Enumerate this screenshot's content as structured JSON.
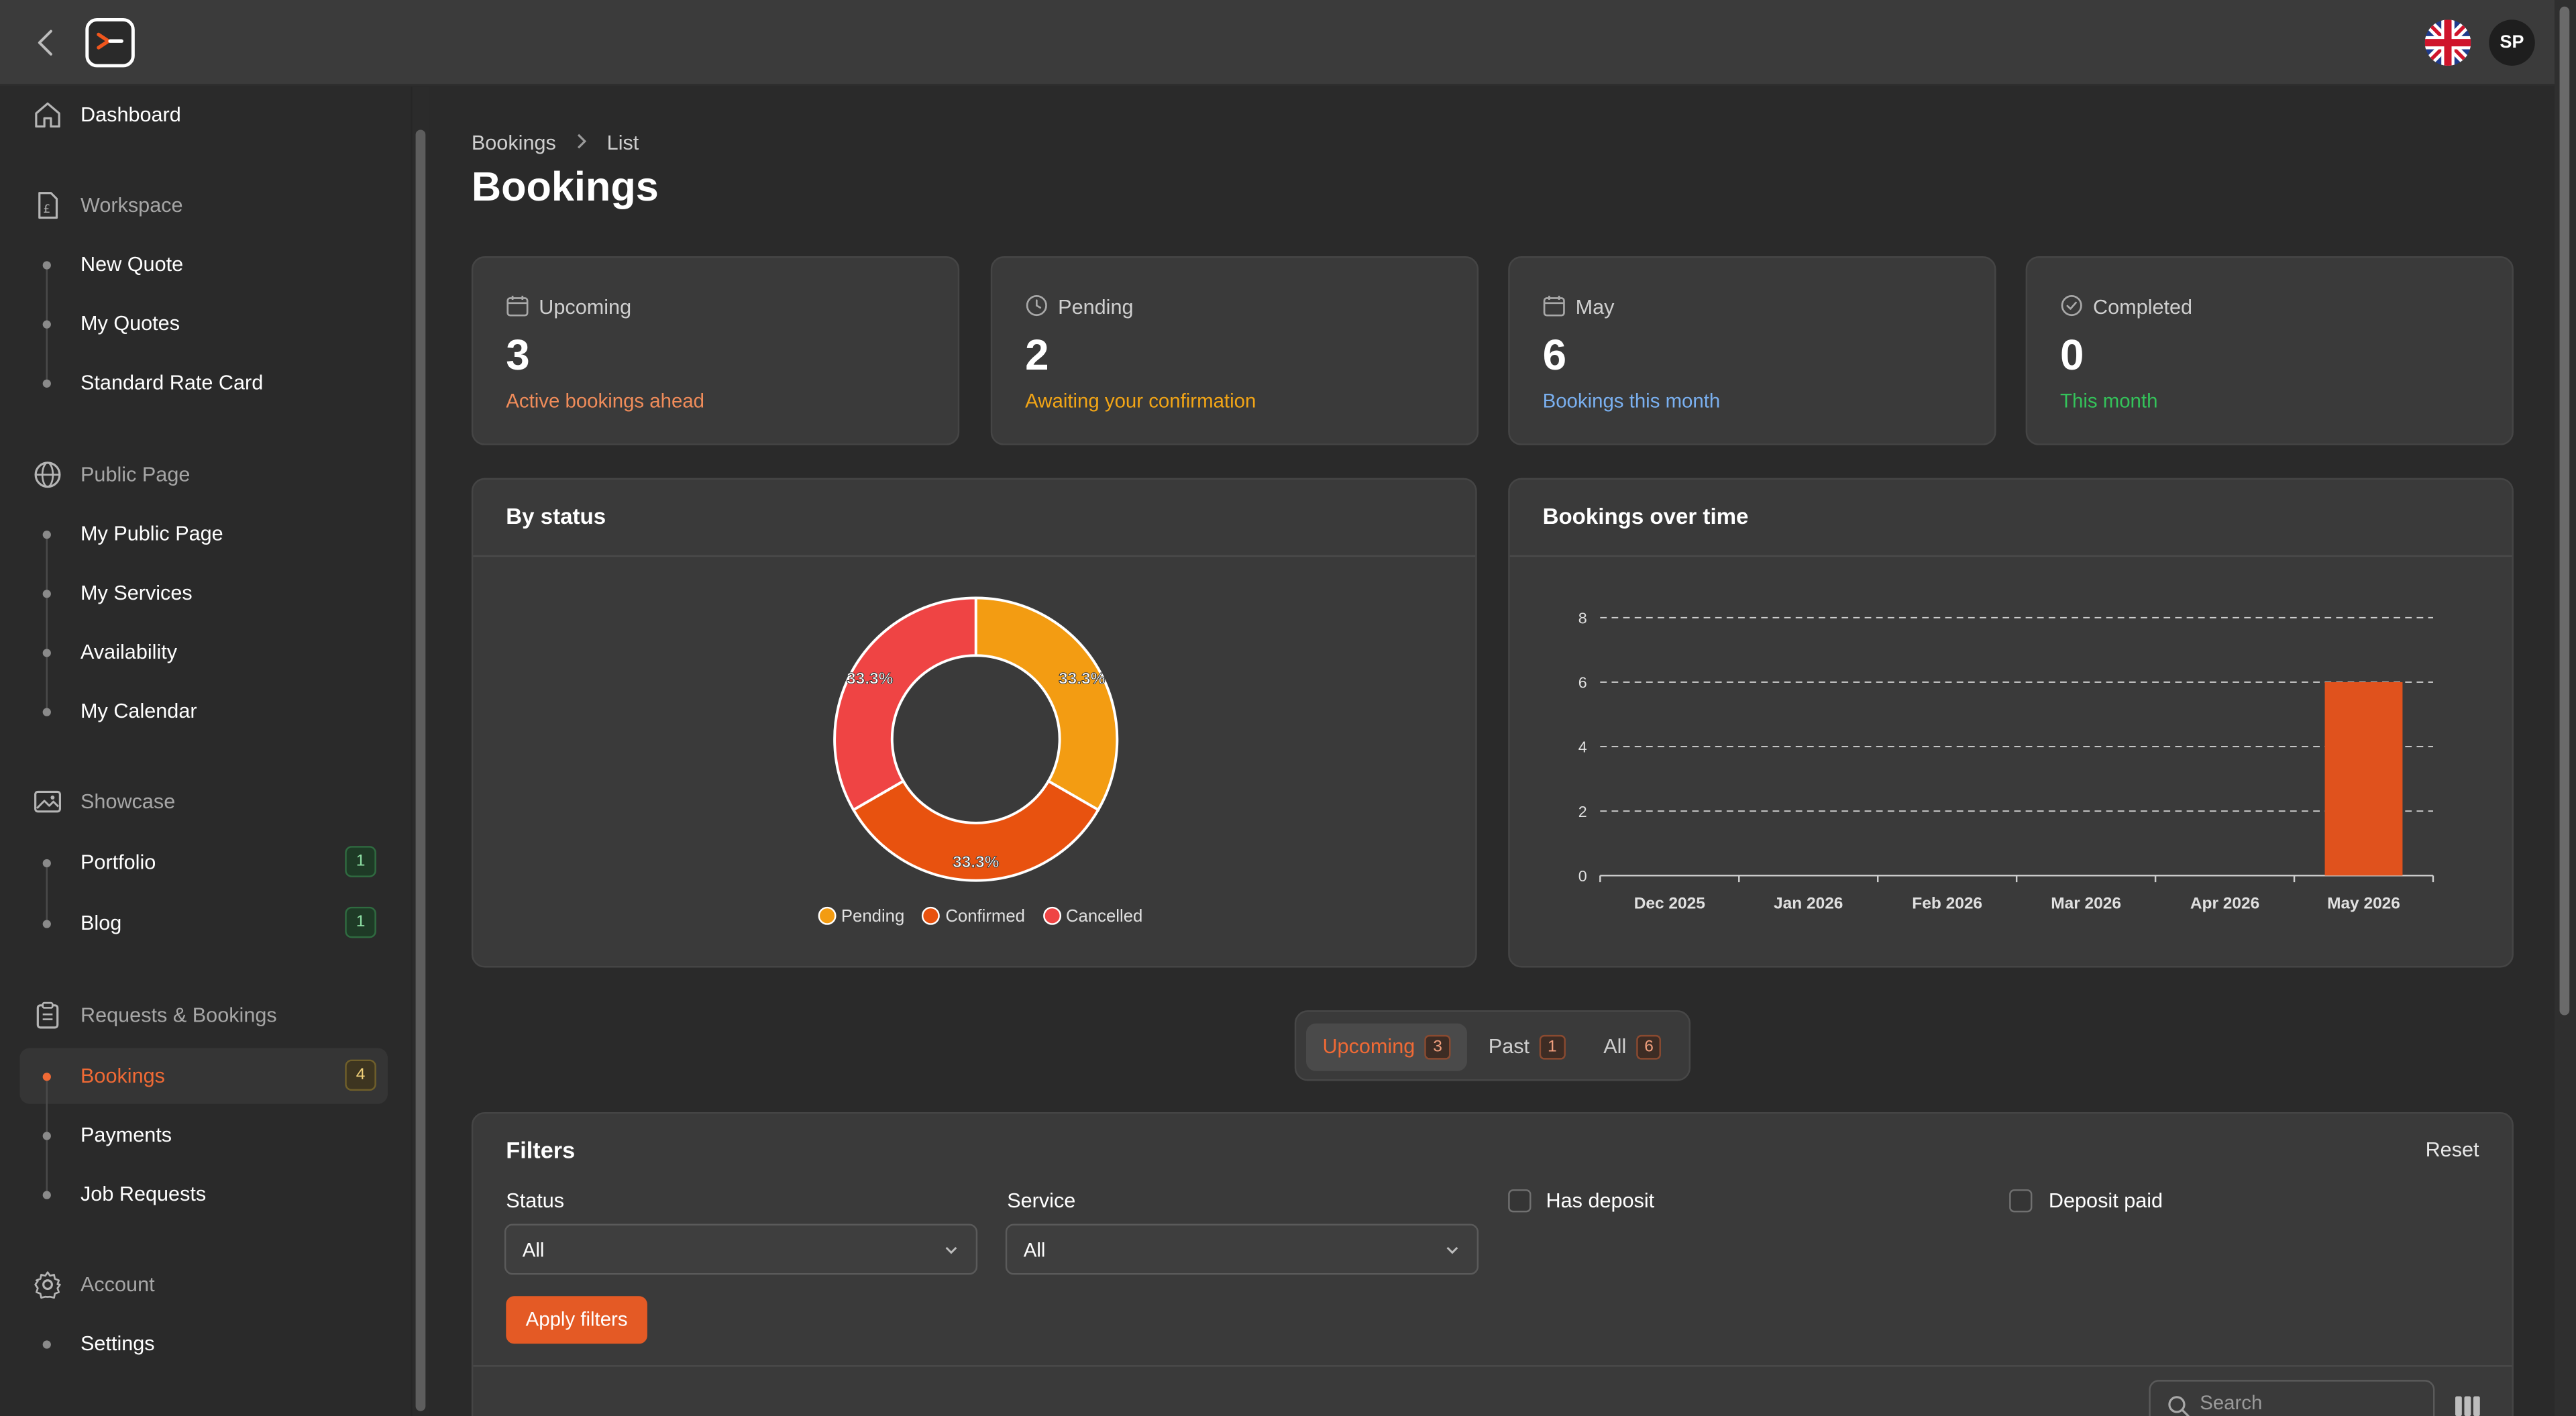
{
  "header": {
    "avatar_initials": "SP",
    "language": "English (UK flag)"
  },
  "sidebar": {
    "items": [
      {
        "label": "Dashboard",
        "icon": "home-icon"
      },
      {
        "label": "Workspace",
        "icon": "invoice-icon"
      },
      {
        "label": "New Quote"
      },
      {
        "label": "My Quotes"
      },
      {
        "label": "Standard Rate Card"
      },
      {
        "label": "Public Page",
        "icon": "globe-icon"
      },
      {
        "label": "My Public Page"
      },
      {
        "label": "My Services"
      },
      {
        "label": "Availability"
      },
      {
        "label": "My Calendar"
      },
      {
        "label": "Showcase",
        "icon": "image-icon"
      },
      {
        "label": "Portfolio",
        "badge": "1"
      },
      {
        "label": "Blog",
        "badge": "1"
      },
      {
        "label": "Requests & Bookings",
        "icon": "clipboard-icon"
      },
      {
        "label": "Bookings",
        "badge": "4"
      },
      {
        "label": "Payments"
      },
      {
        "label": "Job Requests"
      },
      {
        "label": "Account",
        "icon": "gear-icon"
      },
      {
        "label": "Settings"
      }
    ],
    "active_item": "Bookings"
  },
  "breadcrumb": {
    "first": "Bookings",
    "second": "List"
  },
  "page_title": "Bookings",
  "stats": [
    {
      "label": "Upcoming",
      "value": "3",
      "sub": "Active bookings ahead",
      "color": "#f08c5a",
      "icon": "calendar-icon"
    },
    {
      "label": "Pending",
      "value": "2",
      "sub": "Awaiting your confirmation",
      "color": "#f2a516",
      "icon": "clock-icon"
    },
    {
      "label": "May",
      "value": "6",
      "sub": "Bookings this month",
      "color": "#7ab0f0",
      "icon": "calendar-icon"
    },
    {
      "label": "Completed",
      "value": "0",
      "sub": "This month",
      "color": "#34c35a",
      "icon": "check-circle-icon"
    }
  ],
  "status_panel": {
    "title": "By status"
  },
  "time_panel": {
    "title": "Bookings over time"
  },
  "chart_data": [
    {
      "type": "pie",
      "title": "By status",
      "categories": [
        "Pending",
        "Confirmed",
        "Cancelled"
      ],
      "values": [
        33.3,
        33.3,
        33.3
      ],
      "labels": [
        "33.3%",
        "33.3%",
        "33.3%"
      ],
      "colors": [
        "#f39c12",
        "#e8520f",
        "#ef4444"
      ],
      "donut": true,
      "legend": "bottom"
    },
    {
      "type": "bar",
      "title": "Bookings over time",
      "categories": [
        "Dec 2025",
        "Jan 2026",
        "Feb 2026",
        "Mar 2026",
        "Apr 2026",
        "May 2026"
      ],
      "values": [
        0,
        0,
        0,
        0,
        0,
        6
      ],
      "yticks": [
        "0",
        "2",
        "4",
        "6",
        "8"
      ],
      "ylim": [
        0,
        8
      ],
      "grid": true,
      "color": "#e0521d"
    }
  ],
  "tabs": [
    {
      "label": "Upcoming",
      "count": "3"
    },
    {
      "label": "Past",
      "count": "1"
    },
    {
      "label": "All",
      "count": "6"
    }
  ],
  "filters": {
    "title": "Filters",
    "reset": "Reset",
    "status_label": "Status",
    "status_value": "All",
    "service_label": "Service",
    "service_value": "All",
    "has_deposit": "Has deposit",
    "deposit_paid": "Deposit paid",
    "apply": "Apply filters",
    "search_placeholder": "Search"
  }
}
